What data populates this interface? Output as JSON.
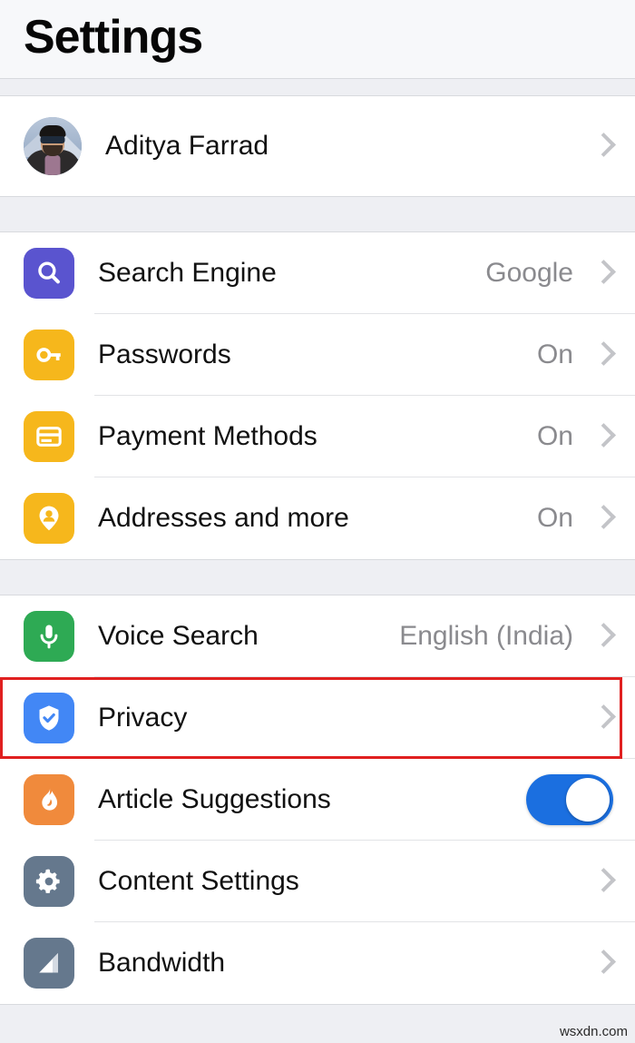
{
  "header": {
    "title": "Settings"
  },
  "profile": {
    "name": "Aditya Farrad",
    "avatar_icon": "user-photo-avatar",
    "chevron_icon": "chevron-right-icon"
  },
  "groups": [
    {
      "id": "account-group",
      "rows": [
        {
          "name": "search-engine",
          "label": "Search Engine",
          "value": "Google",
          "icon": "search-icon",
          "icon_color": "#5a54cf",
          "accessory": "chevron"
        },
        {
          "name": "passwords",
          "label": "Passwords",
          "value": "On",
          "icon": "key-icon",
          "icon_color": "#f6b71c",
          "accessory": "chevron"
        },
        {
          "name": "payment-methods",
          "label": "Payment Methods",
          "value": "On",
          "icon": "credit-card-icon",
          "icon_color": "#f6b71c",
          "accessory": "chevron"
        },
        {
          "name": "addresses-and-more",
          "label": "Addresses and more",
          "value": "On",
          "icon": "location-person-pin-icon",
          "icon_color": "#f6b71c",
          "accessory": "chevron"
        }
      ]
    },
    {
      "id": "browser-group",
      "rows": [
        {
          "name": "voice-search",
          "label": "Voice Search",
          "value": "English (India)",
          "icon": "microphone-icon",
          "icon_color": "#2eaa54",
          "accessory": "chevron"
        },
        {
          "name": "privacy",
          "label": "Privacy",
          "value": "",
          "icon": "shield-check-icon",
          "icon_color": "#4287f5",
          "accessory": "chevron",
          "highlighted": true,
          "highlight_color": "#e02020"
        },
        {
          "name": "article-suggestions",
          "label": "Article Suggestions",
          "value": "",
          "icon": "flame-icon",
          "icon_color": "#f08a3c",
          "accessory": "toggle",
          "toggle_on": true,
          "toggle_color": "#1b6fe0"
        },
        {
          "name": "content-settings",
          "label": "Content Settings",
          "value": "",
          "icon": "gear-icon",
          "icon_color": "#65788d",
          "accessory": "chevron"
        },
        {
          "name": "bandwidth",
          "label": "Bandwidth",
          "value": "",
          "icon": "signal-bars-icon",
          "icon_color": "#65788d",
          "accessory": "chevron"
        }
      ]
    }
  ],
  "footer": {
    "watermark": "wsxdn.com"
  }
}
